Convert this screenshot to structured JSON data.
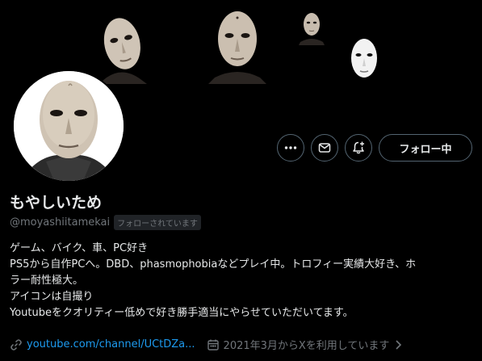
{
  "profile": {
    "display_name": "もやしいため",
    "handle": "@moyashiitamekai",
    "follows_you_badge": "フォローされています",
    "bio_lines": [
      "ゲーム、バイク、車、PC好き",
      "PS5から自作PCへ。DBD、phasmophobiaなどプレイ中。トロフィー実績大好き、ホ",
      "ラー耐性極大。",
      "アイコンは自撮り",
      "Youtubeをクオリティー低めで好き勝手適当にやらせていただいてます。"
    ],
    "link_text": "youtube.com/channel/UCtDZa...",
    "joined_text": "2021年3月からXを利用しています"
  },
  "actions": {
    "more_icon": "more-icon",
    "message_icon": "mail-icon",
    "notify_icon": "bell-plus-icon",
    "follow_label": "フォロー中"
  },
  "banner": {
    "images": [
      "mask",
      "mask",
      "mask",
      "mask",
      "mask"
    ]
  },
  "colors": {
    "background": "#000000",
    "text": "#e7e9ea",
    "muted": "#71767b",
    "link": "#1d9bf0",
    "border": "#536471"
  }
}
